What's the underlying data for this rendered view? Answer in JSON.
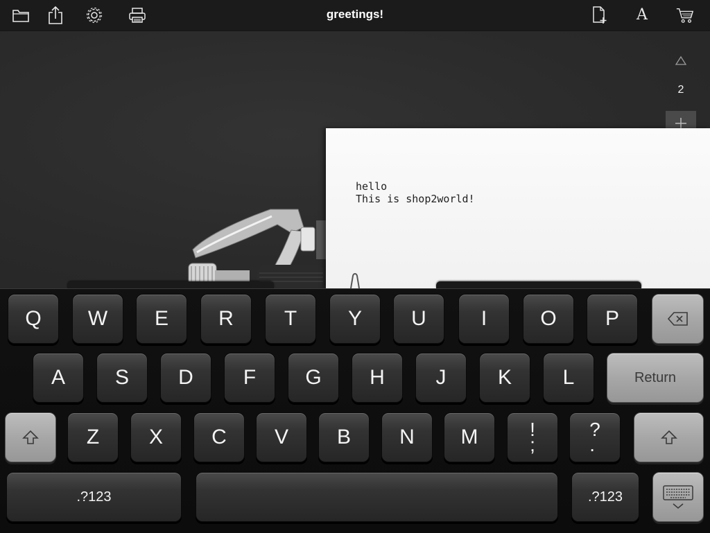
{
  "toolbar": {
    "title": "greetings!",
    "left_icons": [
      "folder-icon",
      "share-icon",
      "gear-icon",
      "printer-icon"
    ],
    "right_icons": [
      "new-document-icon",
      "font-icon",
      "cart-icon"
    ],
    "font_label": "A"
  },
  "pages": {
    "current": "2",
    "up_icon": "triangle-up-icon",
    "add_icon": "plus-icon"
  },
  "paper": {
    "text": "hello\nThis is shop2world!"
  },
  "keyboard": {
    "row1": [
      "Q",
      "W",
      "E",
      "R",
      "T",
      "Y",
      "U",
      "I",
      "O",
      "P"
    ],
    "row2": [
      "A",
      "S",
      "D",
      "F",
      "G",
      "H",
      "J",
      "K",
      "L"
    ],
    "row3": [
      "Z",
      "X",
      "C",
      "V",
      "B",
      "N",
      "M",
      "!\n;",
      "?\n."
    ],
    "return_label": "Return",
    "numbers_label_left": ".?123",
    "numbers_label_right": ".?123",
    "backspace_icon": "backspace-icon",
    "shift_icon": "shift-icon",
    "hide_keyboard_icon": "keyboard-hide-icon"
  },
  "colors": {
    "toolbar_bg": "#1b1b1b",
    "workspace_bg": "#2a2a2a",
    "paper": "#f6f6f6",
    "key_dark": "#2e2e2e",
    "key_light": "#a8a8a8"
  }
}
